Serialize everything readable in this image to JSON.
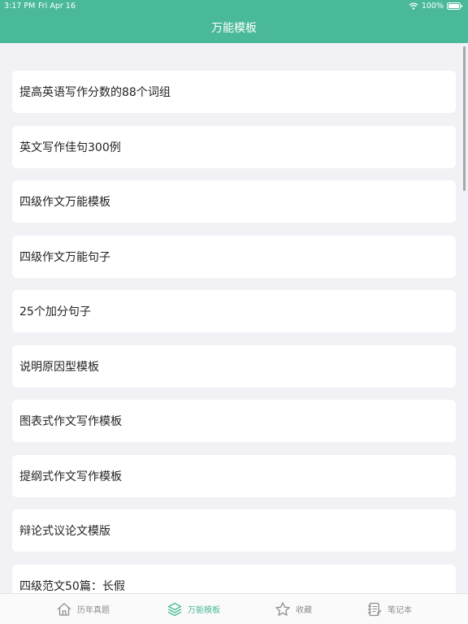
{
  "status_bar": {
    "time": "3:17 PM",
    "date": "Fri Apr 16",
    "battery": "100%",
    "wifi_icon": "wifi-icon",
    "battery_icon": "battery-icon"
  },
  "nav": {
    "title": "万能模板"
  },
  "list": {
    "items": [
      {
        "label": "提高英语写作分数的88个词组"
      },
      {
        "label": "英文写作佳句300例"
      },
      {
        "label": "四级作文万能模板"
      },
      {
        "label": "四级作文万能句子"
      },
      {
        "label": "25个加分句子"
      },
      {
        "label": "说明原因型模板"
      },
      {
        "label": "图表式作文写作模板"
      },
      {
        "label": "提纲式作文写作模板"
      },
      {
        "label": "辩论式议论文模版"
      },
      {
        "label": "四级范文50篇：长假"
      }
    ]
  },
  "tabbar": {
    "tabs": [
      {
        "label": "历年真题",
        "icon": "home-icon",
        "active": false
      },
      {
        "label": "万能模板",
        "icon": "layers-icon",
        "active": true
      },
      {
        "label": "收藏",
        "icon": "star-icon",
        "active": false
      },
      {
        "label": "笔记本",
        "icon": "notebook-icon",
        "active": false
      }
    ],
    "active_color": "#4ab99a",
    "inactive_color": "#8e8e93"
  },
  "colors": {
    "header": "#4ab99a",
    "background": "#f2f2f6",
    "card": "#ffffff"
  }
}
